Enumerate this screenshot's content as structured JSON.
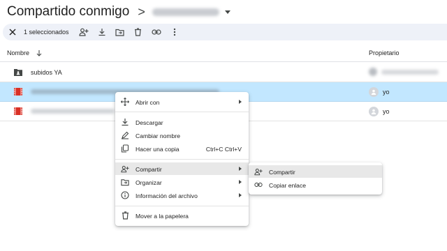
{
  "header": {
    "title": "Compartido conmigo",
    "separator": ">"
  },
  "selection": {
    "count_label": "1 seleccionados"
  },
  "table": {
    "col_name": "Nombre",
    "col_owner": "Propietario",
    "rows": [
      {
        "name": "subidos YA",
        "owner": "",
        "type": "folder",
        "selected": false
      },
      {
        "name": "",
        "owner": "yo",
        "type": "video",
        "selected": true
      },
      {
        "name": "",
        "owner": "yo",
        "type": "video",
        "selected": false
      }
    ]
  },
  "context_menu": {
    "items": [
      {
        "label": "Abrir con",
        "icon": "open-with-icon",
        "submenu": true
      },
      {
        "label": "Descargar",
        "icon": "download-icon"
      },
      {
        "label": "Cambiar nombre",
        "icon": "rename-icon"
      },
      {
        "label": "Hacer una copia",
        "icon": "copy-icon",
        "shortcut": "Ctrl+C Ctrl+V"
      },
      {
        "label": "Compartir",
        "icon": "share-person-add-icon",
        "submenu": true,
        "highlighted": true
      },
      {
        "label": "Organizar",
        "icon": "folder-move-icon",
        "submenu": true
      },
      {
        "label": "Información del archivo",
        "icon": "info-icon",
        "submenu": true
      },
      {
        "label": "Mover a la papelera",
        "icon": "trash-icon"
      }
    ]
  },
  "share_submenu": {
    "items": [
      {
        "label": "Compartir",
        "icon": "share-person-add-icon",
        "highlighted": true
      },
      {
        "label": "Copiar enlace",
        "icon": "link-icon"
      }
    ]
  },
  "colors": {
    "selected_row": "#c2e7ff",
    "toolbar_bg": "#eef1f8",
    "video_icon": "#d93025"
  }
}
